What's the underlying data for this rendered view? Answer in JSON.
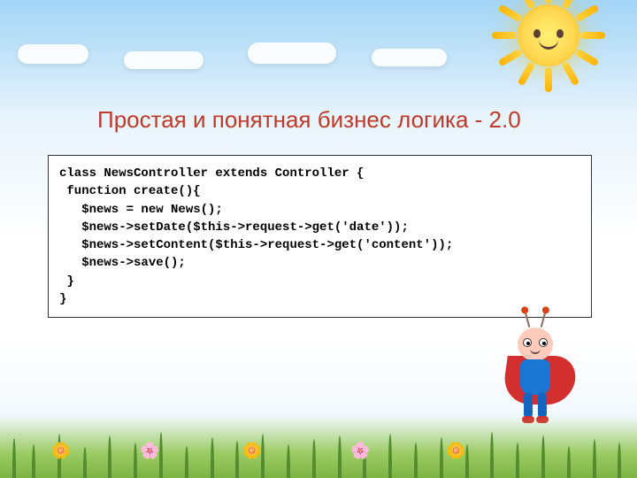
{
  "heading": "Простая и понятная бизнес логика - 2.0",
  "code": "class NewsController extends Controller {\n function create(){\n   $news = new News();\n   $news->setDate($this->request->get('date'));\n   $news->setContent($this->request->get('content'));\n   $news->save();\n }\n}"
}
